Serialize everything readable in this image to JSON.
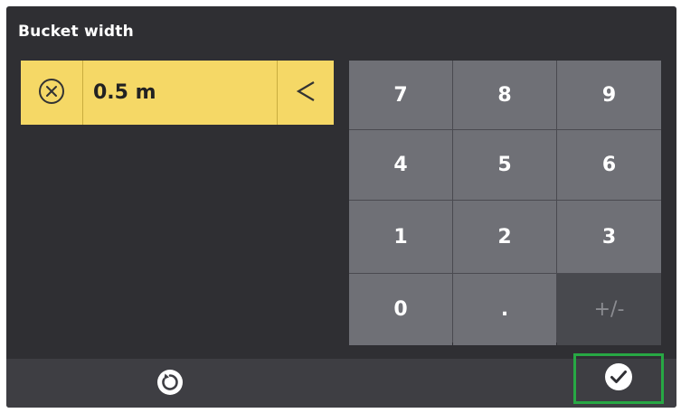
{
  "dialog": {
    "title": "Bucket width"
  },
  "input": {
    "value": "0.5 m",
    "clear_icon": "circle-x-icon",
    "backspace_icon": "chevron-left-icon"
  },
  "keypad": {
    "keys": [
      "7",
      "8",
      "9",
      "4",
      "5",
      "6",
      "1",
      "2",
      "3",
      "0",
      ".",
      "+/-"
    ]
  },
  "footer": {
    "reset_icon": "reset-icon",
    "confirm_icon": "check-circle-icon",
    "confirm_highlight_color": "#27a844"
  },
  "colors": {
    "background": "#2f2f33",
    "input_background": "#f5d866",
    "key_background": "#6f7076",
    "key_disabled_background": "#48494e"
  }
}
